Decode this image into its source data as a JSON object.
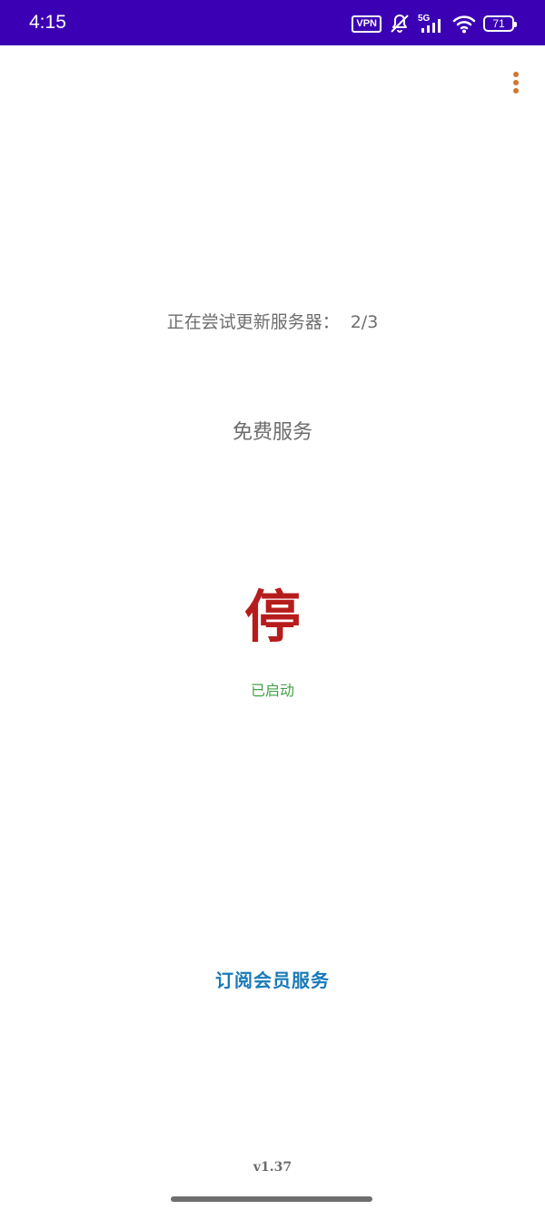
{
  "status_bar": {
    "time": "4:15",
    "vpn_label": "VPN",
    "network_label": "5G",
    "battery_level": "71",
    "background_color": "#3b00b4",
    "icons": [
      "vpn-icon",
      "mute-icon",
      "signal-icon",
      "wifi-icon",
      "battery-icon"
    ]
  },
  "toolbar": {
    "menu_icon": "more-vert-icon",
    "menu_color": "#d2772f"
  },
  "main": {
    "update_status_label": "正在尝试更新服务器：",
    "update_status_count": "2/3",
    "service_type": "免费服务",
    "stop_button_label": "停",
    "stop_button_color": "#b71c1c",
    "running_status": "已启动",
    "running_status_color": "#43a047",
    "subscribe_label": "订阅会员服务",
    "subscribe_color": "#1779b9",
    "version": "v1.37"
  }
}
